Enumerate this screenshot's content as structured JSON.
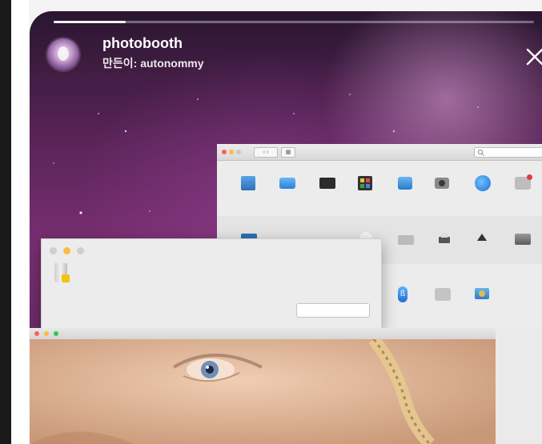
{
  "story": {
    "title": "photobooth",
    "subtitle": "만든이: autonommy",
    "progress": 0.15
  },
  "icons": {
    "close": "close-icon",
    "avatar": "avatar-icon"
  },
  "colors": {
    "background_top": "#2a1630",
    "background_mid": "#7a2f72",
    "traffic_red": "#fc605c",
    "traffic_yellow": "#fdbc40",
    "traffic_green": "#34c84a"
  }
}
